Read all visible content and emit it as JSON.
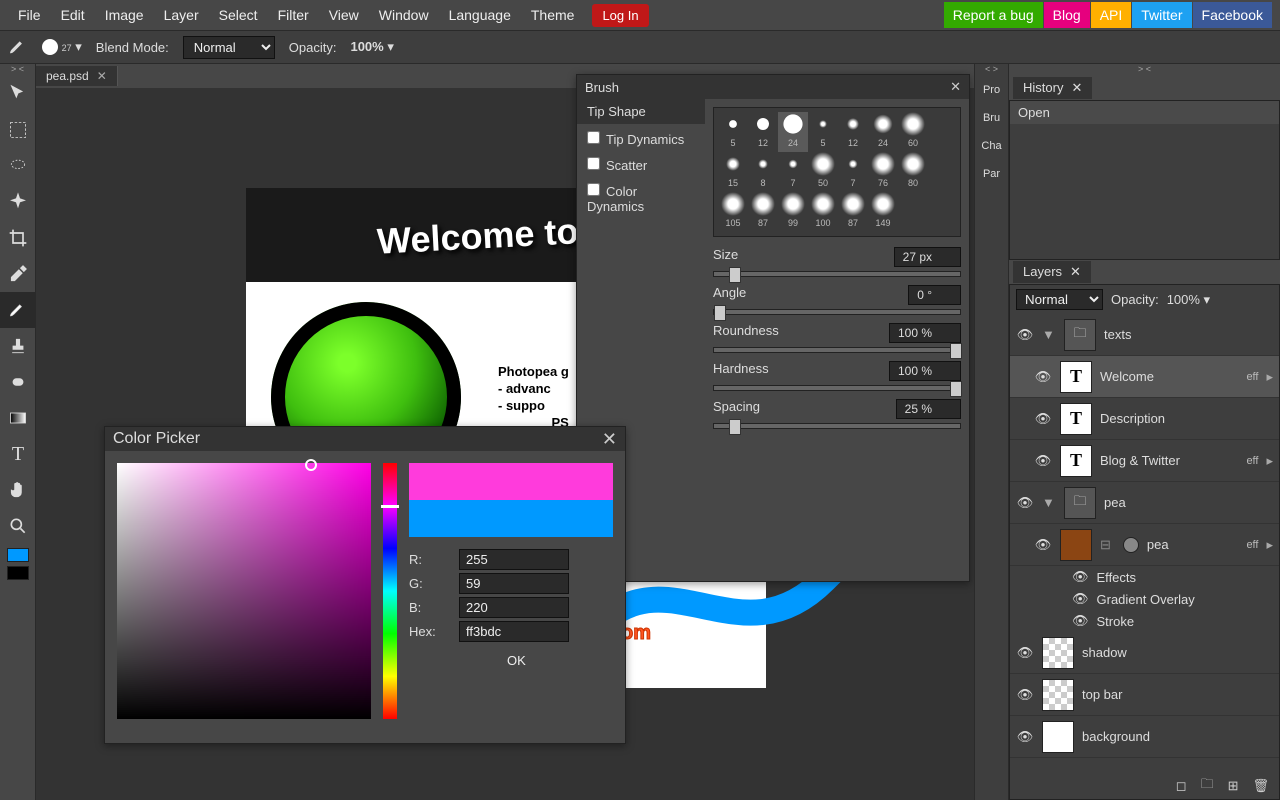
{
  "menu": {
    "file": "File",
    "edit": "Edit",
    "image": "Image",
    "layer": "Layer",
    "select": "Select",
    "filter": "Filter",
    "view": "View",
    "window": "Window",
    "language": "Language",
    "theme": "Theme",
    "login": "Log In"
  },
  "links": {
    "bug": "Report a bug",
    "blog": "Blog",
    "api": "API",
    "twitter": "Twitter",
    "facebook": "Facebook"
  },
  "option": {
    "brush_size": "27",
    "blend_label": "Blend Mode:",
    "blend_value": "Normal",
    "opacity_label": "Opacity:",
    "opacity_value": "100%"
  },
  "doc_tab": "pea.psd",
  "canvas": {
    "title": "Welcome to Ph",
    "title2": "Photopea g",
    "b1": "- advanc",
    "b2": "- suppo",
    "b3": "PS",
    "link1": "om",
    "link2": "om"
  },
  "brush": {
    "title": "Brush",
    "sections": {
      "tip": "Tip Shape",
      "dyn": "Tip Dynamics",
      "scatter": "Scatter",
      "cdyn": "Color Dynamics"
    },
    "tips": [
      {
        "s": "5"
      },
      {
        "s": "12"
      },
      {
        "s": "24",
        "sel": true
      },
      {
        "s": "5"
      },
      {
        "s": "12"
      },
      {
        "s": "24"
      },
      {
        "s": "60"
      },
      {
        "s": "15"
      },
      {
        "s": "8"
      },
      {
        "s": "7"
      },
      {
        "s": "50"
      },
      {
        "s": "7"
      },
      {
        "s": "76"
      },
      {
        "s": "80"
      },
      {
        "s": "105"
      },
      {
        "s": "87"
      },
      {
        "s": "99"
      },
      {
        "s": "100"
      },
      {
        "s": "87"
      },
      {
        "s": "149"
      }
    ],
    "sliders": {
      "size": {
        "label": "Size",
        "value": "27 px",
        "pos": 6
      },
      "angle": {
        "label": "Angle",
        "value": "0 °",
        "pos": 0
      },
      "round": {
        "label": "Roundness",
        "value": "100 %",
        "pos": 96
      },
      "hard": {
        "label": "Hardness",
        "value": "100 %",
        "pos": 96
      },
      "spacing": {
        "label": "Spacing",
        "value": "25 %",
        "pos": 6
      }
    }
  },
  "picker": {
    "title": "Color Picker",
    "r_label": "R:",
    "g_label": "G:",
    "b_label": "B:",
    "hex_label": "Hex:",
    "r": "255",
    "g": "59",
    "b": "220",
    "hex": "ff3bdc",
    "ok": "OK"
  },
  "collapsed": [
    "Pro",
    "Bru",
    "Cha",
    "Par"
  ],
  "history": {
    "title": "History",
    "items": [
      "Open"
    ]
  },
  "layers": {
    "title": "Layers",
    "blend": "Normal",
    "opacity_label": "Opacity:",
    "opacity": "100%",
    "list": [
      {
        "type": "folder",
        "name": "texts",
        "open": true
      },
      {
        "type": "text",
        "name": "Welcome",
        "eff": "eff",
        "indent": 1,
        "sel": true
      },
      {
        "type": "text",
        "name": "Description",
        "indent": 1
      },
      {
        "type": "text",
        "name": "Blog & Twitter",
        "eff": "eff",
        "indent": 1
      },
      {
        "type": "folder",
        "name": "pea",
        "open": true
      },
      {
        "type": "pea",
        "name": "pea",
        "eff": "eff",
        "indent": 1,
        "effects": [
          "Effects",
          "Gradient Overlay",
          "Stroke"
        ]
      },
      {
        "type": "checker",
        "name": "shadow"
      },
      {
        "type": "checker",
        "name": "top bar"
      },
      {
        "type": "white",
        "name": "background"
      }
    ]
  }
}
